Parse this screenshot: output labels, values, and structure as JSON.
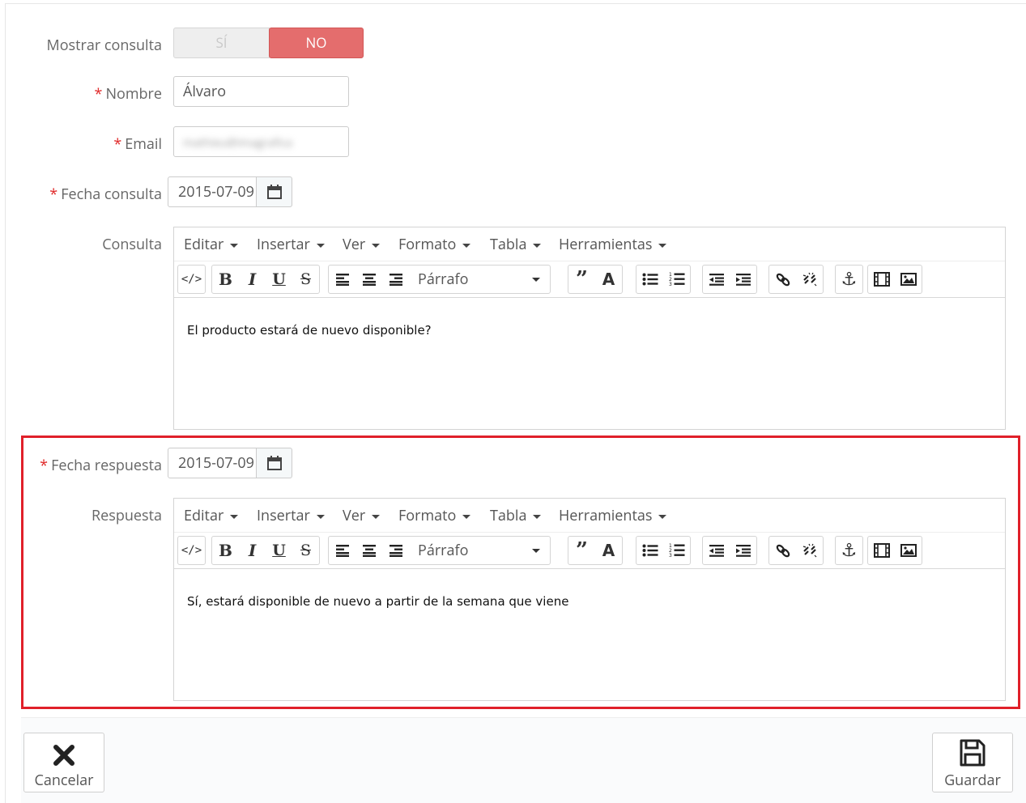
{
  "form": {
    "show_label": "Mostrar consulta",
    "toggle_yes": "SÍ",
    "toggle_no": "NO",
    "required_mark": "*",
    "name_label": "Nombre",
    "name_value": "Álvaro",
    "email_label": "Email",
    "email_value": "mathieu@imagrafica",
    "date_query_label": "Fecha consulta",
    "date_query_value": "2015-07-09",
    "query_label": "Consulta",
    "date_answer_label": "Fecha respuesta",
    "date_answer_value": "2015-07-09",
    "answer_label": "Respuesta"
  },
  "editor": {
    "menu": [
      "Editar",
      "Insertar",
      "Ver",
      "Formato",
      "Tabla",
      "Herramientas"
    ],
    "format_select": "Párrafo",
    "query_text": "El producto estará de nuevo disponible?",
    "answer_text": "Sí, estará disponible de nuevo a partir de la semana que viene"
  },
  "footer": {
    "cancel_label": "Cancelar",
    "save_label": "Guardar"
  },
  "colors": {
    "toggle_no_bg": "#e46d6d",
    "required": "#e02a2a",
    "highlight_border": "#e0202a"
  }
}
